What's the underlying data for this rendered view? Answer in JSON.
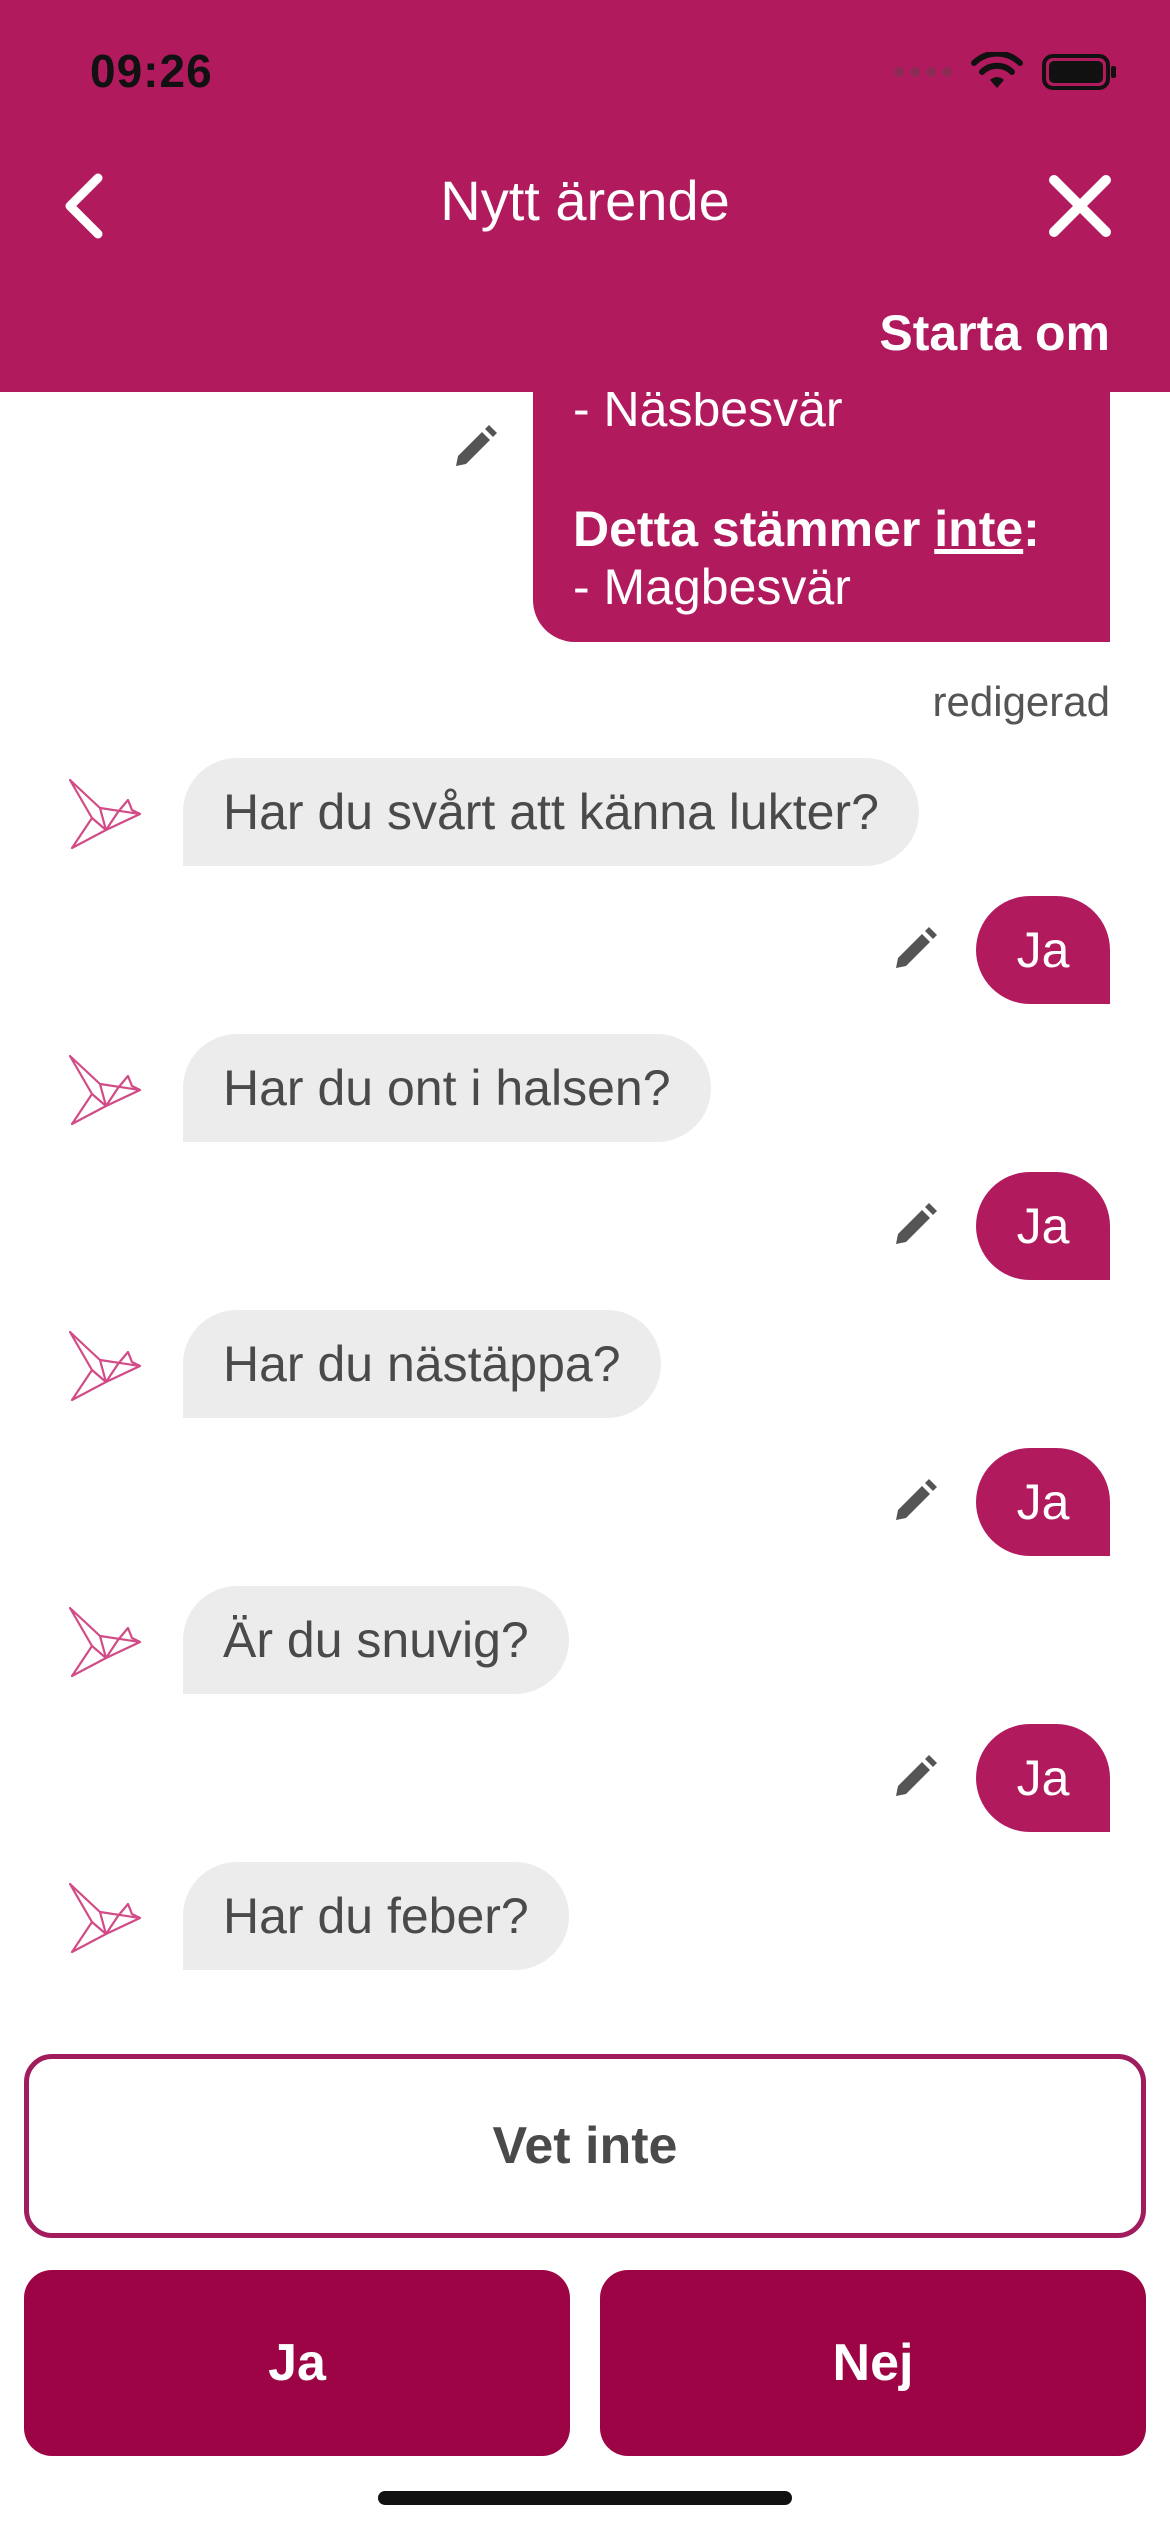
{
  "status_bar": {
    "time": "09:26",
    "icons": [
      "signal-icon",
      "wifi-icon",
      "battery-icon"
    ]
  },
  "header": {
    "title": "Nytt ärende",
    "back_icon": "chevron-left-icon",
    "close_icon": "close-icon",
    "restart_label": "Starta om"
  },
  "summary": {
    "line1": "- Näsbesvär",
    "not_true_prefix": "Detta stämmer ",
    "not_true_emphasis": "inte",
    "not_true_suffix": ":",
    "line3": "- Magbesvär",
    "edited_label": "redigerad"
  },
  "messages": [
    {
      "question": "Har du svårt att känna lukter?",
      "answer": "Ja"
    },
    {
      "question": "Har du ont i halsen?",
      "answer": "Ja"
    },
    {
      "question": "Har du nästäppa?",
      "answer": "Ja"
    },
    {
      "question": "Är du snuvig?",
      "answer": "Ja"
    },
    {
      "question": "Har du feber?"
    }
  ],
  "answers": {
    "unknown": "Vet inte",
    "yes": "Ja",
    "no": "Nej"
  },
  "colors": {
    "brand": "#b11b5e",
    "button": "#9c0446",
    "bot_bubble": "#ececec"
  }
}
